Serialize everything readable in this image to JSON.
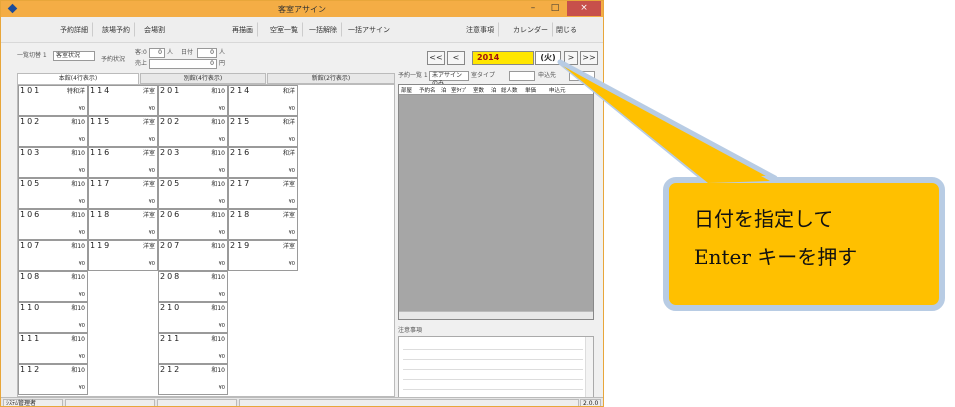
{
  "window": {
    "title": "客室アサイン",
    "minimize": "–",
    "maximize": "□",
    "close": "×"
  },
  "menubar": {
    "left_buttons": [
      "予約詳細",
      "該場予約",
      "会場割"
    ],
    "middle_buttons": [
      "再描画",
      "空室一覧",
      "一括解除",
      "一括アサイン"
    ],
    "right_buttons": [
      "注意事項",
      "カレンダー",
      "閉じる"
    ]
  },
  "filters": {
    "display_label": "一覧切替 1",
    "display_value": "客室状況",
    "status_label": "予約状況",
    "room_label": "客:0",
    "room_value": "0",
    "person_unit": "人",
    "date_label": "日付",
    "date_count": "0",
    "amount_label": "売上",
    "amount_value": "0",
    "yen_unit": "円"
  },
  "date_nav": {
    "first": "<<",
    "prev": "<",
    "date": "2014",
    "weekday": "(火)",
    "next": ">",
    "last": ">>"
  },
  "reservation_filter": {
    "label": "予約一覧 1",
    "value": "未アサインのみ",
    "room_type_label": "室タイプ",
    "applicant_label": "申込先"
  },
  "tabs": [
    "本館(4行表示)",
    "別館(4行表示)",
    "新館(2行表示)"
  ],
  "rooms": [
    {
      "num": "101",
      "type": "特和洋",
      "price": "¥0"
    },
    {
      "num": "102",
      "type": "和10",
      "price": "¥0"
    },
    {
      "num": "103",
      "type": "和10",
      "price": "¥0"
    },
    {
      "num": "105",
      "type": "和10",
      "price": "¥0"
    },
    {
      "num": "106",
      "type": "和10",
      "price": "¥0"
    },
    {
      "num": "107",
      "type": "和10",
      "price": "¥0"
    },
    {
      "num": "108",
      "type": "和10",
      "price": "¥0"
    },
    {
      "num": "110",
      "type": "和10",
      "price": "¥0"
    },
    {
      "num": "111",
      "type": "和10",
      "price": "¥0"
    },
    {
      "num": "112",
      "type": "和10",
      "price": "¥0"
    },
    {
      "num": "114",
      "type": "洋室",
      "price": "¥0"
    },
    {
      "num": "115",
      "type": "洋室",
      "price": "¥0"
    },
    {
      "num": "116",
      "type": "洋室",
      "price": "¥0"
    },
    {
      "num": "117",
      "type": "洋室",
      "price": "¥0"
    },
    {
      "num": "118",
      "type": "洋室",
      "price": "¥0"
    },
    {
      "num": "119",
      "type": "洋室",
      "price": "¥0"
    },
    {
      "num": "201",
      "type": "和10",
      "price": "¥0"
    },
    {
      "num": "202",
      "type": "和10",
      "price": "¥0"
    },
    {
      "num": "203",
      "type": "和10",
      "price": "¥0"
    },
    {
      "num": "205",
      "type": "和10",
      "price": "¥0"
    },
    {
      "num": "206",
      "type": "和10",
      "price": "¥0"
    },
    {
      "num": "207",
      "type": "和10",
      "price": "¥0"
    },
    {
      "num": "208",
      "type": "和10",
      "price": "¥0"
    },
    {
      "num": "210",
      "type": "和10",
      "price": "¥0"
    },
    {
      "num": "211",
      "type": "和10",
      "price": "¥0"
    },
    {
      "num": "212",
      "type": "和10",
      "price": "¥0"
    },
    {
      "num": "214",
      "type": "和洋",
      "price": "¥0"
    },
    {
      "num": "215",
      "type": "和洋",
      "price": "¥0"
    },
    {
      "num": "216",
      "type": "和洋",
      "price": "¥0"
    },
    {
      "num": "217",
      "type": "洋室",
      "price": "¥0"
    },
    {
      "num": "218",
      "type": "洋室",
      "price": "¥0"
    },
    {
      "num": "219",
      "type": "洋室",
      "price": "¥0"
    }
  ],
  "list_columns": [
    "部屋",
    "予約名",
    "泊",
    "室ﾀｲﾌﾟ",
    "室数",
    "泊",
    "総人数",
    "単価",
    "申込元"
  ],
  "notes_label": "注意事項",
  "statusbar": {
    "left": "ｼｽﾃﾑ管理者",
    "version": "2.0.0"
  },
  "callout": {
    "line1": "日付を指定して",
    "line2": "Enter キーを押す",
    "fill_color": "#ffc000",
    "border_color": "#b8cce4"
  },
  "colors": {
    "titlebar": "#f4ad45",
    "date_highlight": "#ffe600",
    "list_background": "#a6a6a6"
  }
}
